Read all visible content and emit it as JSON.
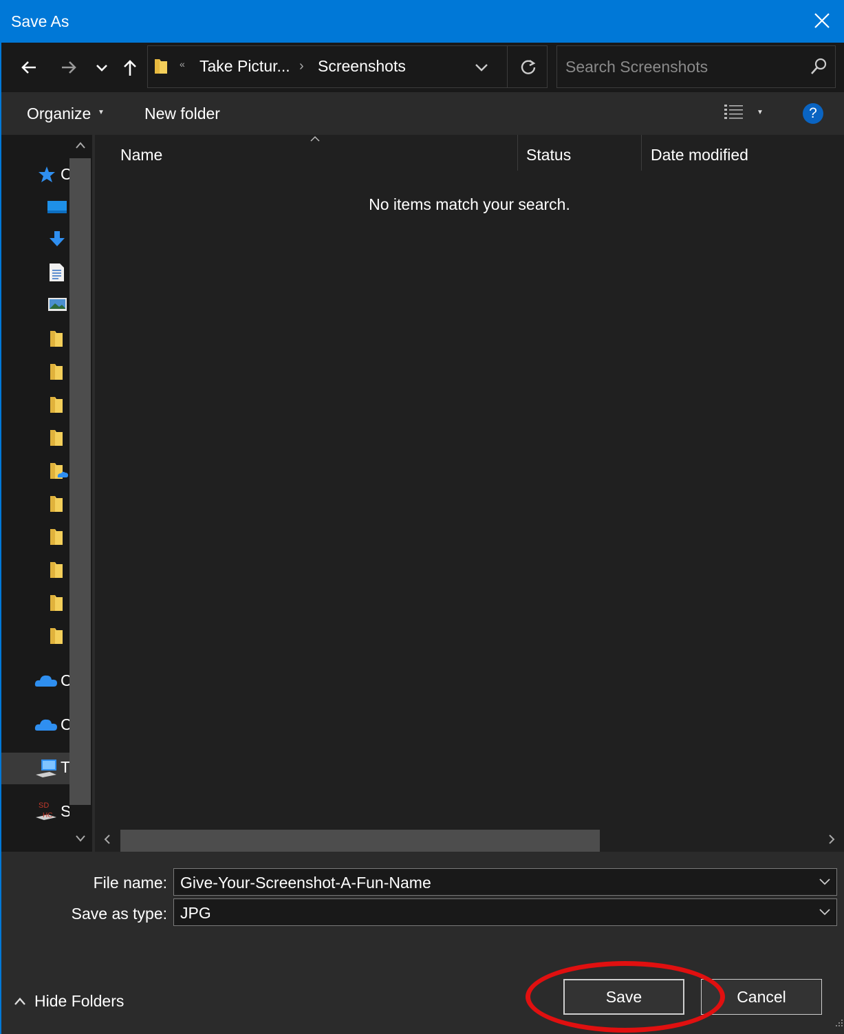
{
  "window": {
    "title": "Save As"
  },
  "address": {
    "crumbs": [
      "Take Pictur...",
      "Screenshots"
    ],
    "overflow_glyph": "«"
  },
  "search": {
    "placeholder": "Search Screenshots"
  },
  "toolbar": {
    "organize": "Organize",
    "new_folder": "New folder",
    "help": "?"
  },
  "nav_pane": {
    "items": [
      {
        "icon": "quick-access-star-icon",
        "label": "C"
      },
      {
        "icon": "desktop-icon",
        "label": ""
      },
      {
        "icon": "downloads-arrow-icon",
        "label": ""
      },
      {
        "icon": "documents-icon",
        "label": ""
      },
      {
        "icon": "pictures-icon",
        "label": ""
      },
      {
        "icon": "folder-icon",
        "label": ""
      },
      {
        "icon": "folder-icon",
        "label": ""
      },
      {
        "icon": "folder-icon",
        "label": ""
      },
      {
        "icon": "folder-icon",
        "label": ""
      },
      {
        "icon": "onedrive-folder-icon",
        "label": ""
      },
      {
        "icon": "folder-icon",
        "label": ""
      },
      {
        "icon": "folder-icon",
        "label": ""
      },
      {
        "icon": "folder-icon",
        "label": ""
      },
      {
        "icon": "folder-icon",
        "label": ""
      },
      {
        "icon": "folder-icon",
        "label": ""
      },
      {
        "icon": "onedrive-cloud-icon",
        "label": "C"
      },
      {
        "icon": "onedrive-cloud-icon",
        "label": "C"
      },
      {
        "icon": "this-pc-icon",
        "label": "T"
      },
      {
        "icon": "sd-card-icon",
        "label": "S"
      }
    ]
  },
  "columns": {
    "name": "Name",
    "status": "Status",
    "date_modified": "Date modified"
  },
  "content": {
    "empty_message": "No items match your search."
  },
  "fields": {
    "file_name_label": "File name:",
    "file_name_value": "Give-Your-Screenshot-A-Fun-Name",
    "save_type_label": "Save as type:",
    "save_type_value": "JPG"
  },
  "footer": {
    "hide_folders": "Hide Folders",
    "save": "Save",
    "cancel": "Cancel"
  },
  "colors": {
    "accent": "#0078d7",
    "highlight_ring": "#e01010",
    "folder": "#f4cf5a"
  }
}
